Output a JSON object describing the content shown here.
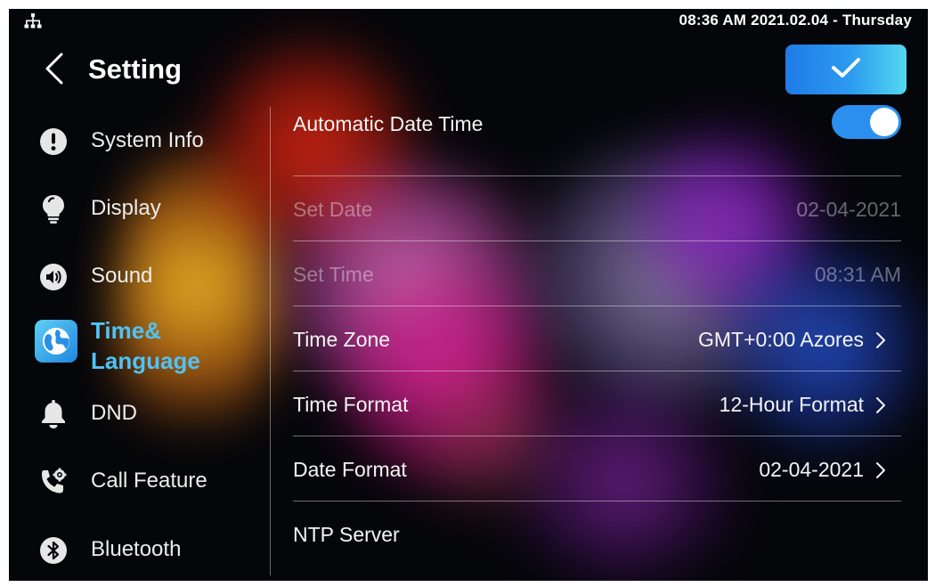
{
  "status_bar": {
    "icons": {
      "network": "network-icon"
    },
    "clock": "08:36 AM  2021.02.04 - Thursday"
  },
  "header": {
    "title": "Setting",
    "icons": {
      "back": "chevron-left-icon",
      "confirm": "check-icon"
    }
  },
  "sidebar": {
    "items": [
      {
        "label": "System Info",
        "icon": "info-icon",
        "active": false
      },
      {
        "label": "Display",
        "icon": "bulb-icon",
        "active": false
      },
      {
        "label": "Sound",
        "icon": "speaker-icon",
        "active": false
      },
      {
        "label_line1": "Time&",
        "label_line2": "Language",
        "icon": "globe-icon",
        "active": true
      },
      {
        "label": "DND",
        "icon": "bell-icon",
        "active": false
      },
      {
        "label": "Call Feature",
        "icon": "phone-settings-icon",
        "active": false
      },
      {
        "label": "Bluetooth",
        "icon": "bluetooth-icon",
        "active": false
      }
    ]
  },
  "settings": {
    "automatic_date_time": {
      "label": "Automatic Date Time",
      "enabled": true
    },
    "set_date": {
      "label": "Set Date",
      "value": "02-04-2021",
      "disabled": true
    },
    "set_time": {
      "label": "Set Time",
      "value": "08:31 AM",
      "disabled": true
    },
    "time_zone": {
      "label": "Time Zone",
      "value": "GMT+0:00 Azores"
    },
    "time_format": {
      "label": "Time Format",
      "value": "12-Hour Format"
    },
    "date_format": {
      "label": "Date Format",
      "value": "02-04-2021"
    },
    "ntp_server": {
      "label": "NTP Server"
    }
  },
  "colors": {
    "accent": "#4fc3f7",
    "toggle_on": "#2b8ff0",
    "confirm_gradient_start": "#1f7ae6",
    "confirm_gradient_end": "#54d8f0",
    "background": "#05060a"
  }
}
